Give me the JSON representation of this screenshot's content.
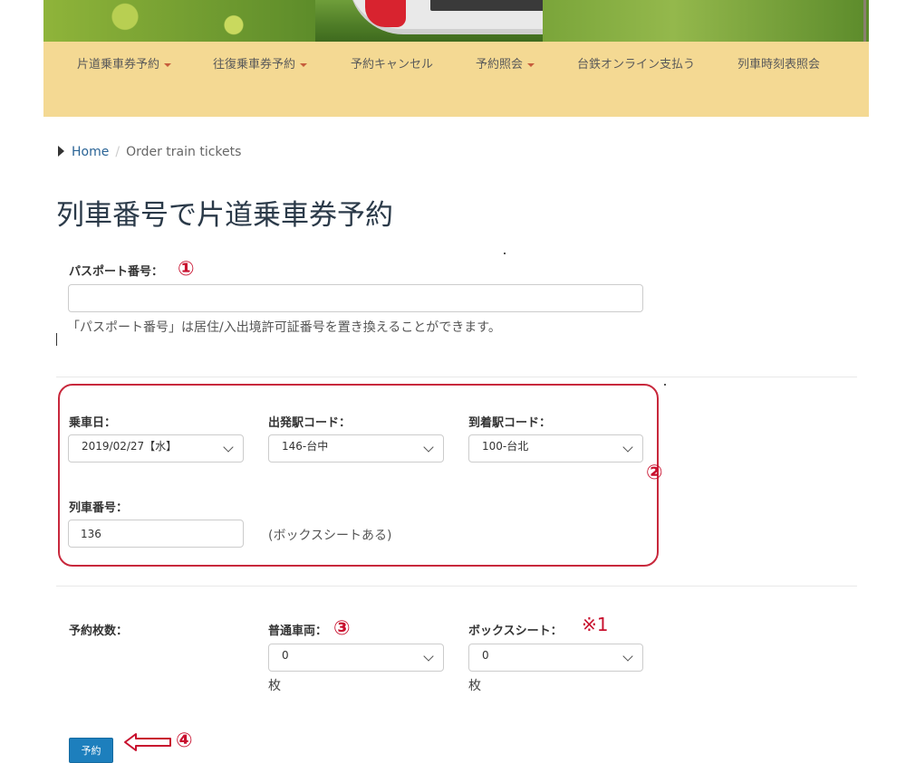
{
  "nav": {
    "items": [
      {
        "label": "片道乗車券予約",
        "dropdown": true
      },
      {
        "label": "往復乗車券予約",
        "dropdown": true
      },
      {
        "label": "予約キャンセル",
        "dropdown": false
      },
      {
        "label": "予約照会",
        "dropdown": true
      },
      {
        "label": "台鉄オンライン支払う",
        "dropdown": false
      },
      {
        "label": "列車時刻表照会",
        "dropdown": false
      }
    ]
  },
  "breadcrumb": {
    "home": "Home",
    "separator": "/",
    "current": "Order train tickets"
  },
  "page_title": "列車番号で片道乗車券予約",
  "passport": {
    "label": "パスポート番号：",
    "value": "",
    "help": "「パスポート番号」は居住/入出境許可証番号を置き換えることができます。"
  },
  "trip": {
    "date_label": "乗車日：",
    "date_value": "2019/02/27【水】",
    "from_label": "出発駅コード：",
    "from_value": "146-台中",
    "to_label": "到着駅コード：",
    "to_value": "100-台北",
    "train_label": "列車番号：",
    "train_value": "136",
    "train_note": "(ボックスシートある)"
  },
  "tickets": {
    "label": "予約枚数：",
    "regular_label": "普通車両：",
    "regular_value": "0",
    "regular_unit": "枚",
    "box_label": "ボックスシート：",
    "box_value": "0",
    "box_unit": "枚"
  },
  "annotations": {
    "one": "①",
    "two": "②",
    "three": "③",
    "four": "④",
    "note_mark": "※1"
  },
  "submit_label": "予約",
  "colors": {
    "nav_bg": "#f4d993",
    "annotation_red": "#c8102e",
    "button_blue": "#1d7fbd",
    "link_blue": "#2a6496"
  }
}
